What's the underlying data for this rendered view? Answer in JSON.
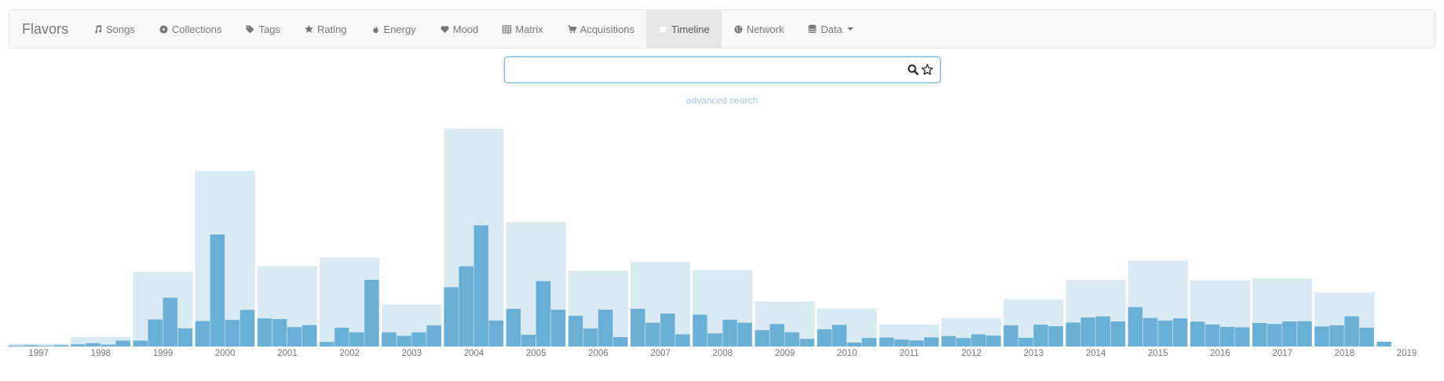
{
  "navbar": {
    "brand": "Flavors",
    "items": [
      {
        "label": "Songs",
        "icon": "music-icon",
        "active": false
      },
      {
        "label": "Collections",
        "icon": "disc-icon",
        "active": false
      },
      {
        "label": "Tags",
        "icon": "tag-icon",
        "active": false
      },
      {
        "label": "Rating",
        "icon": "star-icon",
        "active": false
      },
      {
        "label": "Energy",
        "icon": "flame-icon",
        "active": false
      },
      {
        "label": "Mood",
        "icon": "heart-icon",
        "active": false
      },
      {
        "label": "Matrix",
        "icon": "grid-icon",
        "active": false
      },
      {
        "label": "Acquisitions",
        "icon": "cart-icon",
        "active": false
      },
      {
        "label": "Timeline",
        "icon": "calendar-icon",
        "active": true
      },
      {
        "label": "Network",
        "icon": "globe-icon",
        "active": false
      },
      {
        "label": "Data",
        "icon": "database-icon",
        "active": false,
        "dropdown": true
      }
    ]
  },
  "search": {
    "value": "",
    "placeholder": "",
    "search_icon": "search-icon",
    "favorite_icon": "star-outline-icon"
  },
  "advanced_search": "advanced search",
  "colors": {
    "year_bar": "#daeaf3",
    "quarter_bar": "#6aafd6",
    "axis_text": "#777777",
    "search_focus": "#66afe9"
  },
  "chart_data": {
    "type": "bar",
    "title": "",
    "xlabel": "",
    "ylabel": "",
    "ylim": [
      0,
      100
    ],
    "grid": false,
    "years": [
      "1997",
      "1998",
      "1999",
      "2000",
      "2001",
      "2002",
      "2003",
      "2004",
      "2005",
      "2006",
      "2007",
      "2008",
      "2009",
      "2010",
      "2011",
      "2012",
      "2013",
      "2014",
      "2015",
      "2016",
      "2017",
      "2018",
      "2019"
    ],
    "series": [
      {
        "level": "year",
        "values": [
          1.3,
          4.4,
          34.3,
          80.6,
          36.9,
          40.8,
          19.3,
          100,
          57.1,
          34.8,
          38.8,
          35.1,
          20.6,
          17.4,
          10.1,
          13.0,
          21.8,
          30.6,
          39.5,
          30.3,
          31.3,
          24.9,
          2.2
        ]
      },
      {
        "level": "quarter",
        "values": [
          [
            0.4,
            0.6,
            0.3,
            0.6
          ],
          [
            1.0,
            1.5,
            0.9,
            2.7
          ],
          [
            2.7,
            12.4,
            22.4,
            8.3
          ],
          [
            11.7,
            51.4,
            12.2,
            16.8
          ],
          [
            12.9,
            12.6,
            8.9,
            9.8
          ],
          [
            2.1,
            8.6,
            6.5,
            30.6
          ],
          [
            6.5,
            4.9,
            6.5,
            9.7
          ],
          [
            27.2,
            36.8,
            55.6,
            11.9
          ],
          [
            17.3,
            5.4,
            30.0,
            16.9
          ],
          [
            14.1,
            8.3,
            16.9,
            4.3
          ],
          [
            17.3,
            10.9,
            15.1,
            5.6
          ],
          [
            14.6,
            6.0,
            12.3,
            10.9
          ],
          [
            7.5,
            10.3,
            6.5,
            3.5
          ],
          [
            7.9,
            9.9,
            1.8,
            3.9
          ],
          [
            4.1,
            3.2,
            2.8,
            4.2
          ],
          [
            4.8,
            3.9,
            5.6,
            5.0
          ],
          [
            9.7,
            4.0,
            10.0,
            9.3
          ],
          [
            11.0,
            13.3,
            13.8,
            11.5
          ],
          [
            18.1,
            13.1,
            11.9,
            12.9
          ],
          [
            11.4,
            10.1,
            9.0,
            8.8
          ],
          [
            10.8,
            10.3,
            11.5,
            11.6
          ],
          [
            9.2,
            9.7,
            13.8,
            8.6
          ],
          [
            2.2
          ]
        ]
      }
    ]
  }
}
